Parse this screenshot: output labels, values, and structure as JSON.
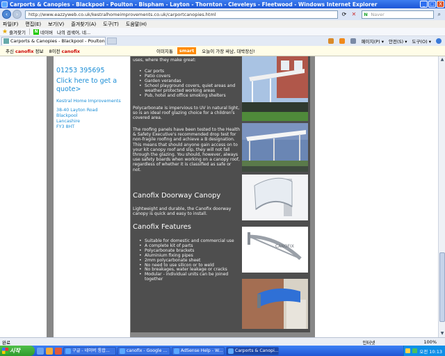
{
  "window": {
    "title": "Carports & Canopies - Blackpool - Poulton - Bispham - Layton - Thornton - Cleveleys - Fleetwood - Windows Internet Explorer",
    "controls": [
      "_",
      "□",
      "X"
    ]
  },
  "address": {
    "url": "http://www.eazzyweb.co.uk/kestralhomeimprovements.co.uk/carportcanopies.html",
    "search_placeholder": "Naver"
  },
  "menu": [
    "파일(F)",
    "편집(E)",
    "보기(V)",
    "즐겨찾기(A)",
    "도구(T)",
    "도움말(H)"
  ],
  "favorites": {
    "label": "즐겨찾기",
    "items": [
      "네이버",
      "나의 검색어, 네..."
    ]
  },
  "tab": {
    "label": "Carports & Canopies - Blackpool - Poulton - ..."
  },
  "commands": [
    "페이지(P)",
    "안전(S)",
    "도구(O)"
  ],
  "toolbar_strip": {
    "item1_prefix": "추신",
    "item1_bold": "canofix",
    "item1_suffix": "정보",
    "item2_prefix": "8이전",
    "item2_bold": "canofix",
    "item3": "이미지통",
    "smart": "smart",
    "item4": "오늘이 가장 싸남, 대박장신!"
  },
  "sidebar": {
    "phone": "01253 395695",
    "quote_link": "Click here to get a quote>",
    "company": "Kestral Home Improvements",
    "address_lines": [
      "38-40 Layton Road",
      "Blackpool",
      "Lancashire",
      "FY3 8HT"
    ]
  },
  "main": {
    "intro": "uses, where they make great:",
    "uses": [
      "Car ports",
      "Patio covers",
      "Garden verandas",
      "School playground covers, quiet areas and weather protected working areas",
      "Pub, hotel and office smoking shelters"
    ],
    "para1": "Polycarbonate is impervious to UV in natural light, so is an ideal roof glazing choice for a children's covered area.",
    "para2": "The roofing panels have been tested to the Health & Safety Executive's recommended drop test for non-fragile roofing and achieve a B designation. This means that should anyone gain access on to your kit canopy roof and slip, they will not fall through the glazing. You should, however, always use safety boards when working on a canopy roof, regardless of whether it is classified as safe or not.",
    "doorway_heading": "Canofix Doorway Canopy",
    "doorway_text": "Lightweight and durable, the Canofix doorway canopy is quick and easy to install.",
    "features_heading": "Canofix Features",
    "features": [
      "Suitable for domestic and commercial use",
      "A complete kit of parts",
      "Polycarbonate brackets",
      "Aluminium fixing pipes",
      "2mm polycarbonate sheet",
      "No need to use silicon or to weld",
      "No breakages, water leakage or cracks",
      "Modular - individual units can be joined together"
    ],
    "bracket_logo": "CANOFIX"
  },
  "status": {
    "text": "완료",
    "zone": "인터넷",
    "zoom": "100%"
  },
  "taskbar": {
    "start": "시작",
    "tasks": [
      "구글 - 네이버 통합...",
      "canofix - Google ...",
      "AdSense Help - W...",
      "Carports & Canopi..."
    ],
    "clock": "오전 10:13"
  }
}
